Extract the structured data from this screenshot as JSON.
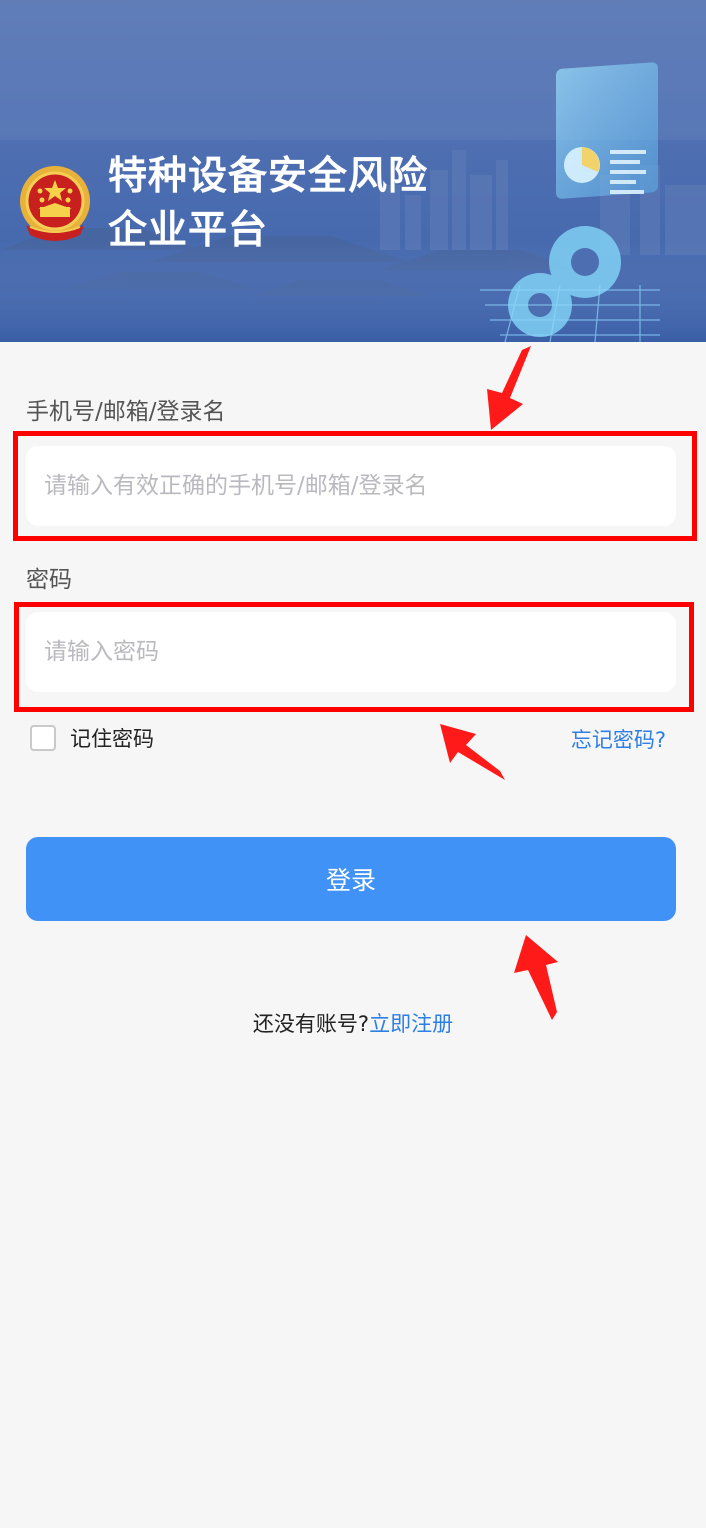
{
  "banner": {
    "title_line1": "特种设备安全风险",
    "title_line2": "企业平台"
  },
  "form": {
    "account": {
      "label": "手机号/邮箱/登录名",
      "placeholder": "请输入有效正确的手机号/邮箱/登录名"
    },
    "password": {
      "label": "密码",
      "placeholder": "请输入密码"
    },
    "remember_label": "记住密码",
    "forgot_label": "忘记密码?",
    "login_label": "登录",
    "no_account_text": "还没有账号?",
    "register_label": "立即注册"
  },
  "colors": {
    "accent": "#4192f6",
    "link": "#2e7fe4",
    "highlight": "#ff0000",
    "banner": "#4d6eb1"
  },
  "icons": [
    "national-emblem-icon",
    "checkbox-icon",
    "annotation-arrow-icon"
  ]
}
